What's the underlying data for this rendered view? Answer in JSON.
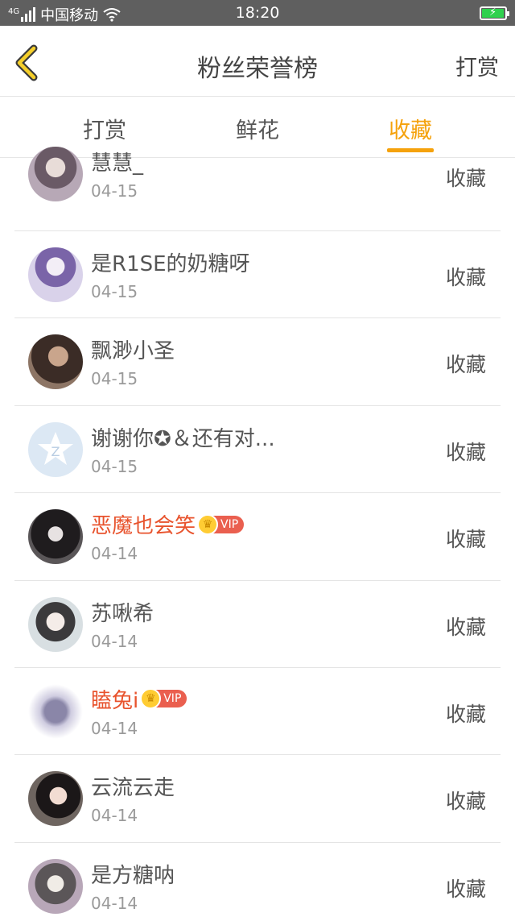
{
  "status_bar": {
    "network": "4G",
    "carrier": "中国移动",
    "time": "18:20"
  },
  "header": {
    "title": "粉丝荣誉榜",
    "action": "打赏"
  },
  "tabs": [
    {
      "label": "打赏"
    },
    {
      "label": "鲜花"
    },
    {
      "label": "收藏"
    }
  ],
  "rows": [
    {
      "name": "慧慧_",
      "date": "04-15",
      "action": "收藏",
      "vip": false
    },
    {
      "name": "是R1SE的奶糖呀",
      "date": "04-15",
      "action": "收藏",
      "vip": false
    },
    {
      "name": "飘渺小圣",
      "date": "04-15",
      "action": "收藏",
      "vip": false
    },
    {
      "name": "谢谢你✪＆还有对...",
      "date": "04-15",
      "action": "收藏",
      "vip": false
    },
    {
      "name": "恶魔也会笑",
      "date": "04-14",
      "action": "收藏",
      "vip": true,
      "badge": "VIP"
    },
    {
      "name": "苏啾希",
      "date": "04-14",
      "action": "收藏",
      "vip": false
    },
    {
      "name": "瞌兔i",
      "date": "04-14",
      "action": "收藏",
      "vip": true,
      "badge": "VIP"
    },
    {
      "name": "云流云走",
      "date": "04-14",
      "action": "收藏",
      "vip": false
    },
    {
      "name": "是方糖呐",
      "date": "04-14",
      "action": "收藏",
      "vip": false
    }
  ],
  "colors": {
    "accent": "#f5a20c",
    "vip_name": "#e8532d",
    "status_bar": "#5f5f5f"
  },
  "icons": {
    "back": "chevron-left-icon",
    "wifi": "wifi-icon",
    "battery": "battery-charging-icon"
  }
}
